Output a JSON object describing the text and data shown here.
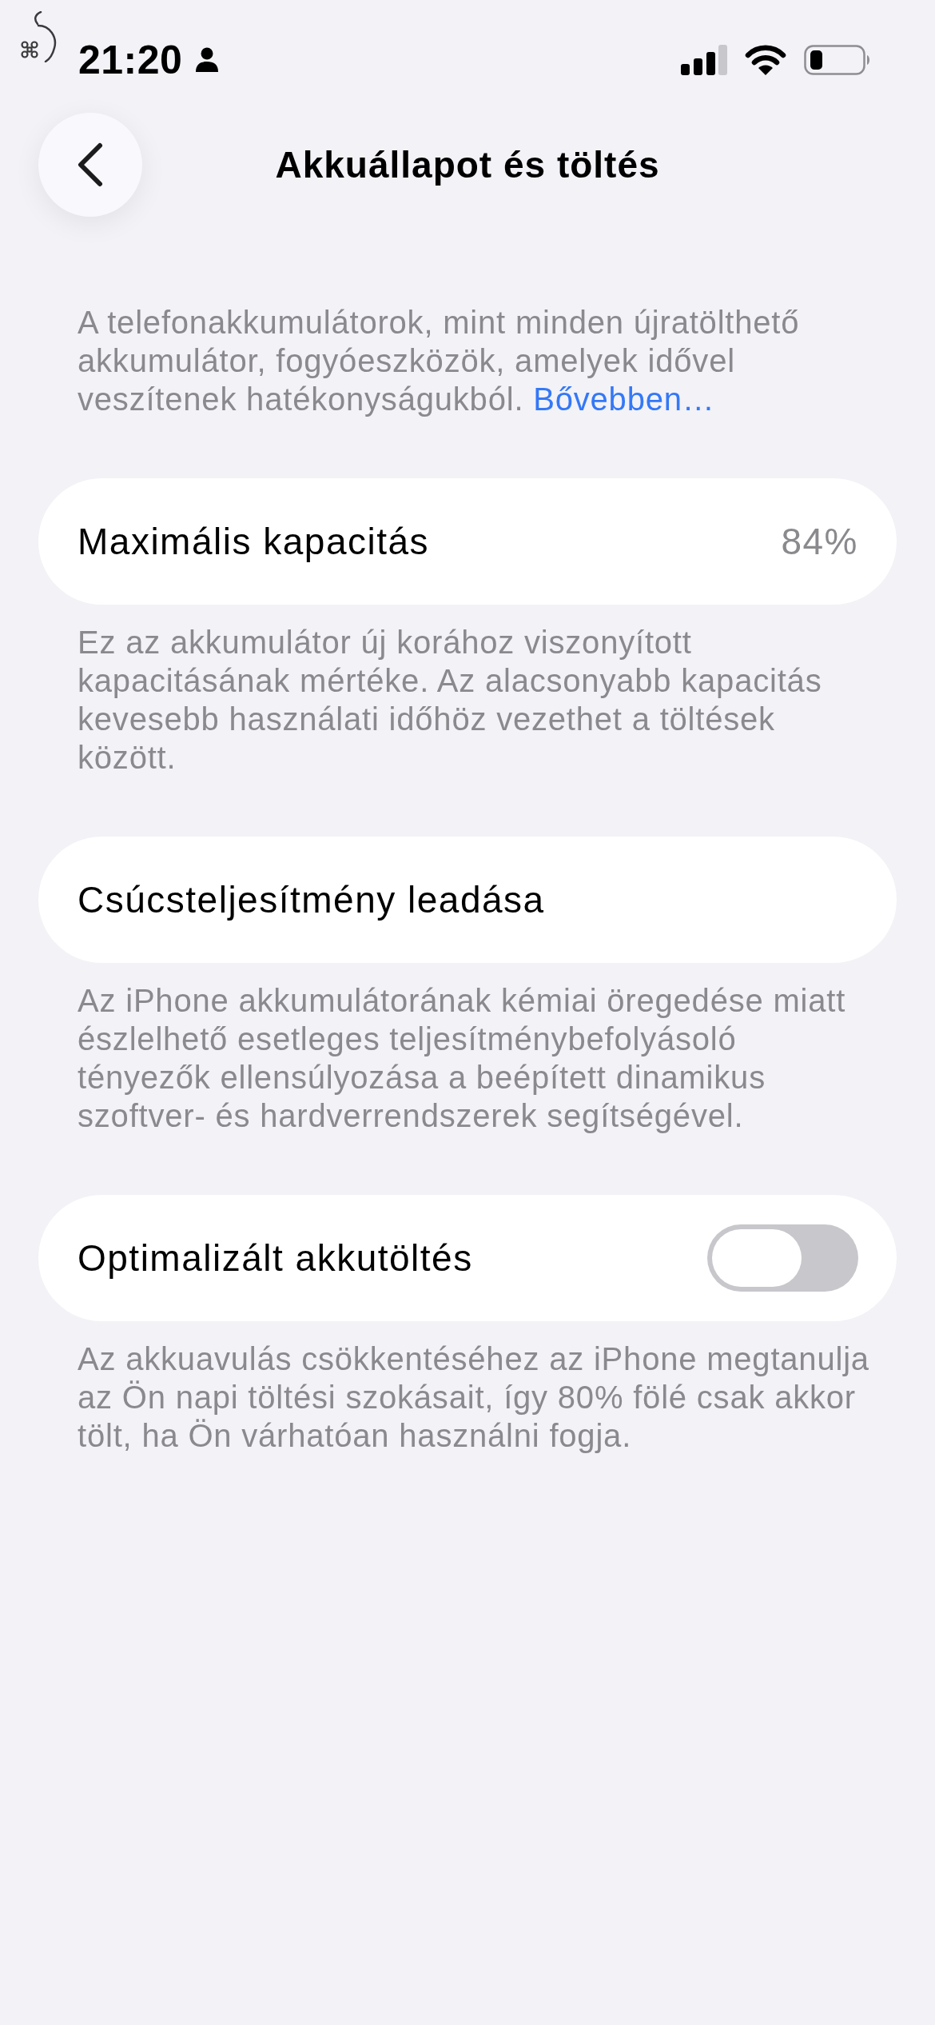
{
  "status_bar": {
    "time": "21:20"
  },
  "navigation": {
    "title": "Akkuállapot és töltés"
  },
  "intro": {
    "text": "A telefonakkumulátorok, mint minden újratölthető akkumulátor, fogyóeszközök, amelyek idővel veszítenek hatékonyságukból.",
    "link": "Bővebben…"
  },
  "sections": [
    {
      "kind": "value",
      "label": "Maximális kapacitás",
      "value": "84%",
      "footer": "Ez az akkumulátor új korához viszonyított kapacitásának mértéke. Az alacsonyabb kapacitás kevesebb használati időhöz vezethet a töltések között."
    },
    {
      "kind": "plain",
      "label": "Csúcsteljesítmény leadása",
      "footer": "Az iPhone akkumulátorának kémiai öregedése miatt észlelhető esetleges teljesítménybefolyásoló tényezők ellensúlyozása a beépített dinamikus szoftver- és hardverrendszerek segítségével."
    },
    {
      "kind": "toggle",
      "label": "Optimalizált akkutöltés",
      "on": false,
      "footer": "Az akkuavulás csökkentéséhez az iPhone megtanulja az Ön napi töltési szokásait, így 80% fölé csak akkor tölt, ha Ön várhatóan használni fogja."
    }
  ]
}
